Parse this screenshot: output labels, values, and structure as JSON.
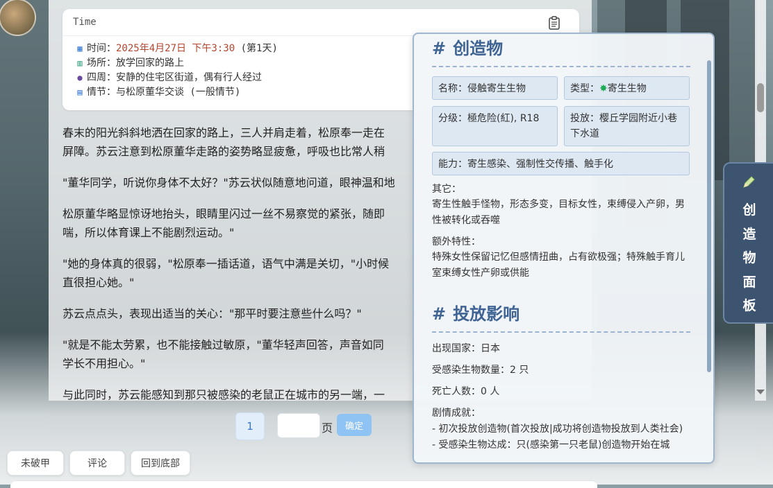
{
  "time_card": {
    "header": "Time",
    "date_label": "时间：",
    "date_value": "2025年4月27日 下午3:30",
    "day_suffix": "(第1天)",
    "place_label": "场所：",
    "place_value": "放学回家的路上",
    "surround_label": "四周：",
    "surround_value": "安静的住宅区街道，偶有行人经过",
    "plot_label": "情节：",
    "plot_value": "与松原董华交谈 (一般情节)",
    "icons": [
      "calendar-icon",
      "map-icon",
      "people-icon",
      "book-icon",
      "clipboard-icon"
    ]
  },
  "story": [
    "春末的阳光斜斜地洒在回家的路上，三人并肩走着，松原奉一走在",
    "屏障。苏云注意到松原董华走路的姿势略显疲惫，呼吸也比常人稍",
    "\"董华同学，听说你身体不太好？\"苏云状似随意地问道，眼神温和地",
    "松原董华略显惊讶地抬头，眼睛里闪过一丝不易察觉的紧张，随即",
    "喘，所以体育课上不能剧烈运动。\"",
    "\"她的身体真的很弱，\"松原奉一插话道，语气中满是关切，\"小时候",
    "直很担心她。\"",
    "苏云点点头，表现出适当的关心：\"那平时要注意些什么吗？\"",
    "\"就是不能太劳累，也不能接触过敏原，\"董华轻声回答，声音如同",
    "学长不用担心。\"",
    "与此同时，苏云能感知到那只被感染的老鼠正在城市的另一端，一"
  ],
  "pager": {
    "current_page": "1",
    "page_input": "",
    "page_suffix": "页",
    "confirm": "确定"
  },
  "bottom_buttons": [
    "未破甲",
    "评论",
    "回到底部"
  ],
  "creature": {
    "title": "创造物",
    "name": "名称：侵触寄生生物",
    "type_label": "类型：",
    "type_value": "寄生生物",
    "grade": "分级：極危险(紅), R18",
    "release": "投放：樱丘学园附近小巷下水道",
    "ability": "能力：寄生感染、强制性交传播、触手化",
    "other_label": "其它：",
    "other_text": "寄生性触手怪物，形态多变，目标女性，束缚侵入产卵，男性被转化或吞噬",
    "extra_label": "额外特性：",
    "extra_text": "特殊女性保留记忆但感情扭曲，占有欲极强；特殊触手育儿室束缚女性产卵或供能",
    "impact_title": "投放影响",
    "country": "出现国家：日本",
    "infected": "受感染生物数量：2 只",
    "deaths": "死亡人数：0 人",
    "plot_label": "剧情成就：",
    "plot_line1": "- 初次投放创造物(首次投放|成功将创造物投放到人类社会)",
    "plot_line2": "- 受感染生物达成：只(感染第一只老鼠)创造物开始在城"
  },
  "side_tab": {
    "label": "创造物面板",
    "chars": [
      "创",
      "造",
      "物",
      "面",
      "板"
    ]
  },
  "colors": {
    "accent": "#3f6494",
    "highlight": "#b5452f",
    "side_tab_bg": "#3d5470",
    "confirm_bg": "#8fc3f4"
  }
}
